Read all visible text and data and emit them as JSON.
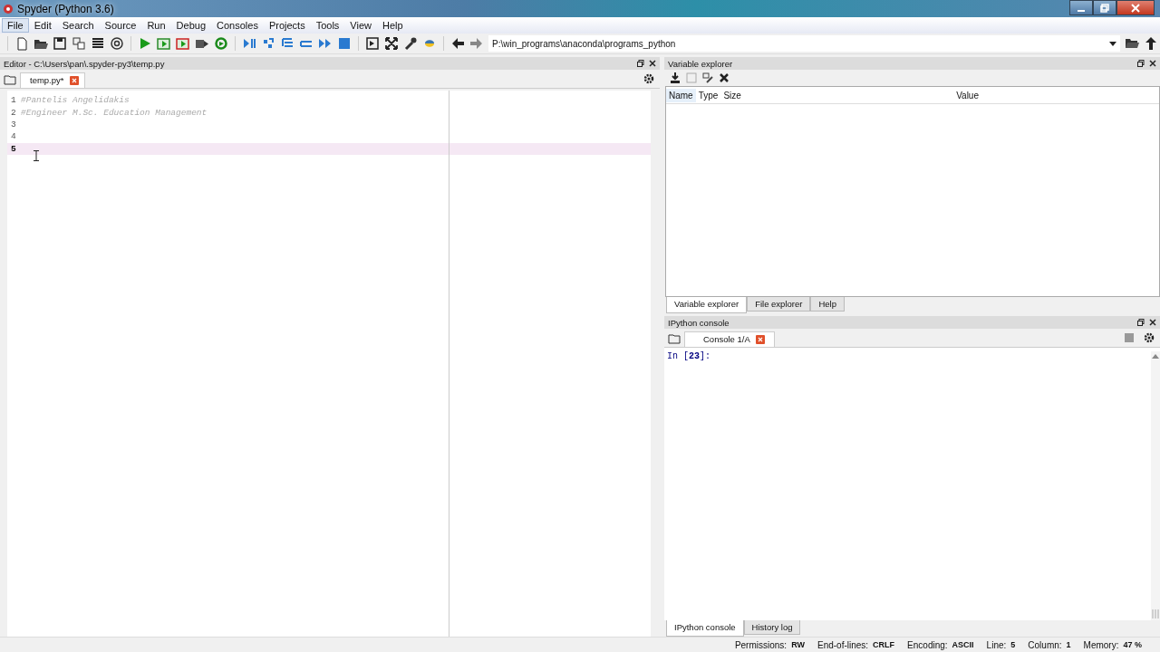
{
  "window": {
    "title": "Spyder (Python 3.6)"
  },
  "menu": [
    {
      "label": "File",
      "selected": true
    },
    {
      "label": "Edit",
      "selected": false
    },
    {
      "label": "Search",
      "selected": false
    },
    {
      "label": "Source",
      "selected": false
    },
    {
      "label": "Run",
      "selected": false
    },
    {
      "label": "Debug",
      "selected": false
    },
    {
      "label": "Consoles",
      "selected": false
    },
    {
      "label": "Projects",
      "selected": false
    },
    {
      "label": "Tools",
      "selected": false
    },
    {
      "label": "View",
      "selected": false
    },
    {
      "label": "Help",
      "selected": false
    }
  ],
  "toolbar": {
    "path": "P:\\win_programs\\anaconda\\programs_python"
  },
  "editor": {
    "title": "Editor - C:\\Users\\pan\\.spyder-py3\\temp.py",
    "tabs": [
      {
        "label": "temp.py*",
        "selected": true
      }
    ],
    "lines": [
      {
        "number": "1",
        "text": "#Pantelis Angelidakis",
        "current": false
      },
      {
        "number": "2",
        "text": "#Engineer M.Sc. Education Management",
        "current": false
      },
      {
        "number": "3",
        "current": false
      },
      {
        "number": "4",
        "current": false
      },
      {
        "number": "5",
        "current": true
      }
    ]
  },
  "variable_explorer": {
    "title": "Variable explorer",
    "columns": [
      "Name",
      "Type",
      "Size",
      "Value"
    ]
  },
  "top_tabs": [
    {
      "label": "Variable explorer",
      "selected": true
    },
    {
      "label": "File explorer",
      "selected": false
    },
    {
      "label": "Help",
      "selected": false
    }
  ],
  "console": {
    "title": "IPython console",
    "tabs": [
      {
        "label": "Console 1/A",
        "selected": true
      }
    ],
    "prompt": "In [**23**]:"
  },
  "bottom_tabs": [
    {
      "label": "IPython console",
      "selected": true
    },
    {
      "label": "History log",
      "selected": false
    }
  ],
  "status_bar": [
    {
      "label": "Permissions:",
      "value": "RW"
    },
    {
      "label": "End-of-lines:",
      "value": "CRLF"
    },
    {
      "label": "Encoding:",
      "value": "ASCII"
    },
    {
      "label": "Line:",
      "value": "5"
    },
    {
      "label": "Column:",
      "value": "1"
    },
    {
      "label": "Memory:",
      "value": "47 %"
    }
  ]
}
